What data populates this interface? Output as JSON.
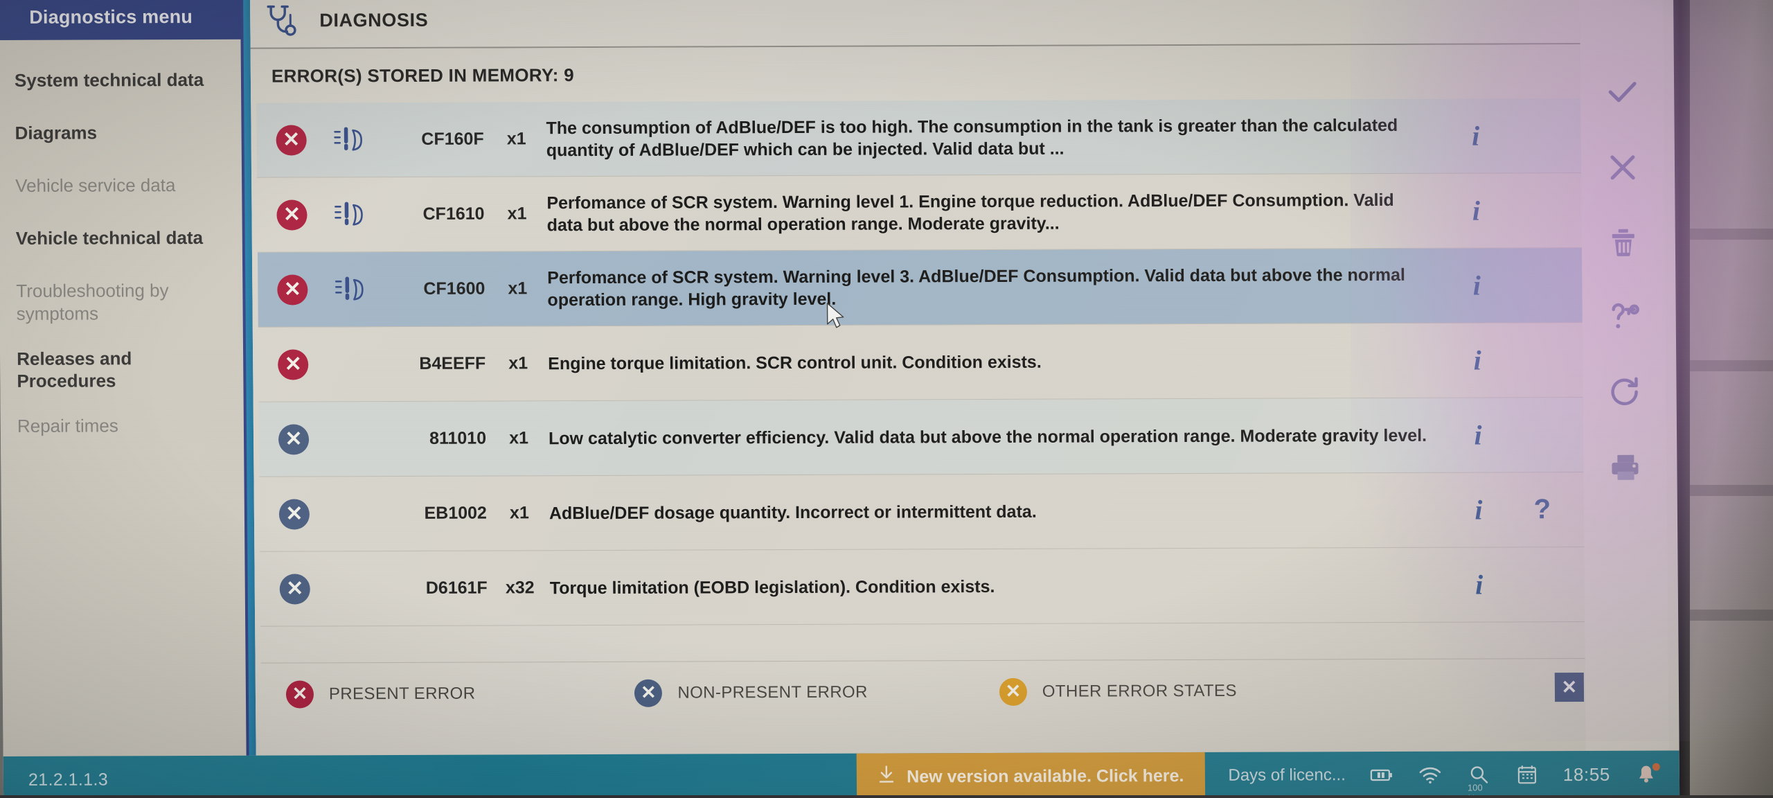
{
  "sidebar": {
    "header_title": "Diagnostics menu",
    "items": [
      {
        "label": "System technical data",
        "dim": false
      },
      {
        "label": "Diagrams",
        "dim": false
      },
      {
        "label": "Vehicle service data",
        "dim": true
      },
      {
        "label": "Vehicle technical data",
        "dim": false
      },
      {
        "label": "Troubleshooting by symptoms",
        "dim": true
      },
      {
        "label": "Releases and Procedures",
        "dim": false
      },
      {
        "label": "Repair times",
        "dim": true
      }
    ]
  },
  "main": {
    "header_title": "DIAGNOSIS",
    "header_icon": "stethoscope-icon",
    "error_count_label": "ERROR(S) STORED IN MEMORY: 9",
    "columns": {
      "status": "",
      "warning": "",
      "code": "",
      "qty": "",
      "description": ""
    },
    "rows": [
      {
        "status": "present",
        "status_glyph": "✕",
        "warning_icon": "dashboard-warning-icon",
        "has_warning_icon": true,
        "code": "CF160F",
        "qty": "x1",
        "description": "The consumption of AdBlue/DEF is too high. The consumption in the tank is greater than the calculated quantity of AdBlue/DEF which can be injected. Valid data but ...",
        "actions": {
          "info": true,
          "help": false,
          "wrench": true
        },
        "selected": false
      },
      {
        "status": "present",
        "status_glyph": "✕",
        "warning_icon": "dashboard-warning-icon",
        "has_warning_icon": true,
        "code": "CF1610",
        "qty": "x1",
        "description": "Perfomance of SCR system. Warning level 1. Engine torque reduction. AdBlue/DEF Consumption. Valid data but above the normal operation range. Moderate gravity...",
        "actions": {
          "info": true,
          "help": false,
          "wrench": true
        },
        "selected": false
      },
      {
        "status": "present",
        "status_glyph": "✕",
        "warning_icon": "dashboard-warning-icon",
        "has_warning_icon": true,
        "code": "CF1600",
        "qty": "x1",
        "description": "Perfomance of SCR system. Warning level 3. AdBlue/DEF Consumption. Valid data but above the normal operation range. High gravity level.",
        "actions": {
          "info": true,
          "help": false,
          "wrench": true
        },
        "selected": true
      },
      {
        "status": "present",
        "status_glyph": "✕",
        "warning_icon": "",
        "has_warning_icon": false,
        "code": "B4EEFF",
        "qty": "x1",
        "description": "Engine torque limitation. SCR control unit. Condition exists.",
        "actions": {
          "info": true,
          "help": false,
          "wrench": false
        },
        "selected": false
      },
      {
        "status": "nonpresent",
        "status_glyph": "✕",
        "warning_icon": "",
        "has_warning_icon": false,
        "code": "811010",
        "qty": "x1",
        "description": "Low catalytic converter efficiency. Valid data but above the normal operation range. Moderate gravity level.",
        "actions": {
          "info": true,
          "help": false,
          "wrench": true
        },
        "selected": false
      },
      {
        "status": "nonpresent",
        "status_glyph": "✕",
        "warning_icon": "",
        "has_warning_icon": false,
        "code": "EB1002",
        "qty": "x1",
        "description": "AdBlue/DEF dosage quantity. Incorrect or intermittent data.",
        "actions": {
          "info": true,
          "help": true,
          "wrench": true
        },
        "selected": false
      },
      {
        "status": "nonpresent",
        "status_glyph": "✕",
        "warning_icon": "",
        "has_warning_icon": false,
        "code": "D6161F",
        "qty": "x32",
        "description": "Torque limitation (EOBD legislation). Condition exists.",
        "actions": {
          "info": true,
          "help": false,
          "wrench": false
        },
        "selected": false
      }
    ],
    "legend": [
      {
        "key": "present",
        "glyph": "✕",
        "label": "PRESENT ERROR",
        "color": "#a81838"
      },
      {
        "key": "nonpresent",
        "glyph": "✕",
        "label": "NON-PRESENT ERROR",
        "color": "#45597d"
      },
      {
        "key": "other",
        "glyph": "✕",
        "label": "OTHER ERROR STATES",
        "color": "#d89a22"
      }
    ],
    "close_button_glyph": "✕"
  },
  "rail": {
    "buttons": [
      {
        "name": "confirm-check-icon",
        "icon": "check-icon"
      },
      {
        "name": "cancel-close-icon",
        "icon": "close-icon"
      },
      {
        "name": "delete-trash-icon",
        "icon": "trash-icon"
      },
      {
        "name": "help-key-icon",
        "icon": "question-key-icon"
      },
      {
        "name": "refresh-icon",
        "icon": "refresh-icon"
      },
      {
        "name": "print-icon",
        "icon": "printer-icon"
      }
    ]
  },
  "taskbar": {
    "version": "21.2.1.1.3",
    "update_text": "New version available. Click here.",
    "update_icon": "download-icon",
    "license_text": "Days of licenc...",
    "tray": [
      {
        "name": "battery-icon",
        "label": ""
      },
      {
        "name": "wifi-icon",
        "label": ""
      },
      {
        "name": "search-icon",
        "label": "100 %"
      },
      {
        "name": "calendar-icon",
        "label": ""
      }
    ],
    "clock": "18:55",
    "bell_icon": "notification-bell-icon"
  },
  "colors": {
    "sidebar_header": "#27387c",
    "sidebar_bg": "#cdc9bf",
    "panel_bg": "#d6d3cb",
    "selected_row": "#9fb4c6",
    "accent_blue": "#204a86",
    "taskbar": "#18788f",
    "update_amber": "#d49a35",
    "present_red": "#a81838",
    "nonpresent_blue": "#45597d",
    "other_amber": "#d89a22"
  }
}
